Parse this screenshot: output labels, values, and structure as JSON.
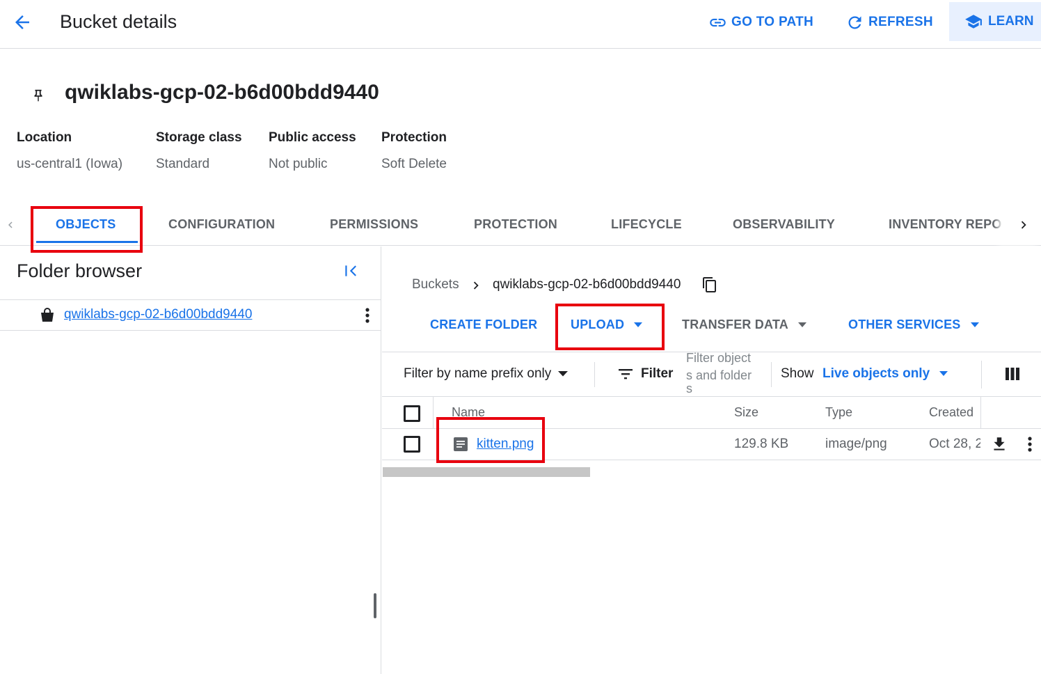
{
  "header": {
    "title": "Bucket details",
    "actions": {
      "go_to_path": "GO TO PATH",
      "refresh": "REFRESH",
      "learn": "LEARN"
    }
  },
  "bucket": {
    "name": "qwiklabs-gcp-02-b6d00bdd9440",
    "meta": [
      {
        "label": "Location",
        "value": "us-central1 (Iowa)"
      },
      {
        "label": "Storage class",
        "value": "Standard"
      },
      {
        "label": "Public access",
        "value": "Not public"
      },
      {
        "label": "Protection",
        "value": "Soft Delete"
      }
    ]
  },
  "tabs": [
    {
      "label": "OBJECTS",
      "active": true
    },
    {
      "label": "CONFIGURATION"
    },
    {
      "label": "PERMISSIONS"
    },
    {
      "label": "PROTECTION"
    },
    {
      "label": "LIFECYCLE"
    },
    {
      "label": "OBSERVABILITY"
    },
    {
      "label": "INVENTORY REPO"
    }
  ],
  "folder_browser": {
    "title": "Folder browser",
    "items": [
      {
        "label": "qwiklabs-gcp-02-b6d00bdd9440"
      }
    ]
  },
  "breadcrumb": {
    "root": "Buckets",
    "current": "qwiklabs-gcp-02-b6d00bdd9440"
  },
  "object_actions": {
    "create_folder": "CREATE FOLDER",
    "upload": "UPLOAD",
    "transfer_data": "TRANSFER DATA",
    "other_services": "OTHER SERVICES"
  },
  "filter_bar": {
    "prefix_mode": "Filter by name prefix only",
    "filter_label": "Filter",
    "filter_placeholder_line1": "Filter object",
    "filter_placeholder_line2": "s and folder",
    "filter_placeholder_line3": "s",
    "show_label": "Show",
    "show_value": "Live objects only"
  },
  "table": {
    "columns": [
      "Name",
      "Size",
      "Type",
      "Created"
    ],
    "rows": [
      {
        "name": "kitten.png",
        "size": "129.8 KB",
        "type": "image/png",
        "created": "Oct 28, 2"
      }
    ]
  },
  "colors": {
    "accent": "#1a73e8",
    "highlight": "#e8000e",
    "learn_bg": "#e8f0fe"
  }
}
